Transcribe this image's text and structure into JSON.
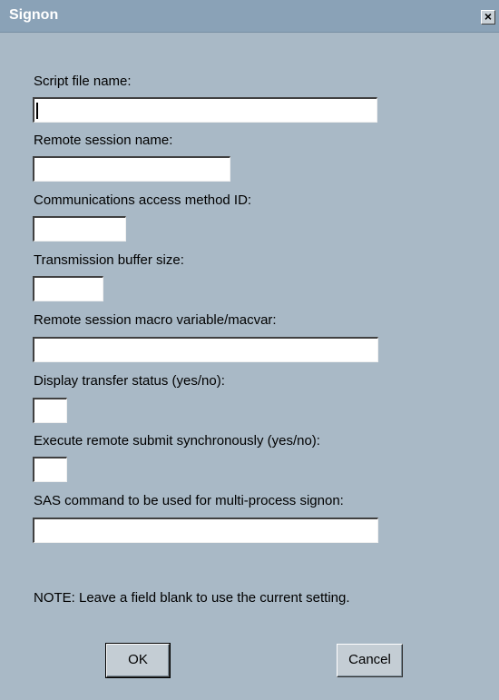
{
  "window": {
    "title": "Signon",
    "close_glyph": "×"
  },
  "fields": [
    {
      "label": "Script file name:",
      "value": ""
    },
    {
      "label": "Remote session name:",
      "value": ""
    },
    {
      "label": "Communications access method ID:",
      "value": ""
    },
    {
      "label": "Transmission buffer size:",
      "value": ""
    },
    {
      "label": "Remote session macro variable/macvar:",
      "value": ""
    },
    {
      "label": "Display transfer status (yes/no):",
      "value": ""
    },
    {
      "label": "Execute remote submit synchronously (yes/no):",
      "value": ""
    },
    {
      "label": "SAS command to be used for multi-process signon:",
      "value": ""
    }
  ],
  "note": "NOTE: Leave a field blank to use the current setting.",
  "buttons": {
    "ok": "OK",
    "cancel": "Cancel"
  },
  "colors": {
    "background": "#a9b9c6",
    "titlebar": "#8aa2b7"
  }
}
